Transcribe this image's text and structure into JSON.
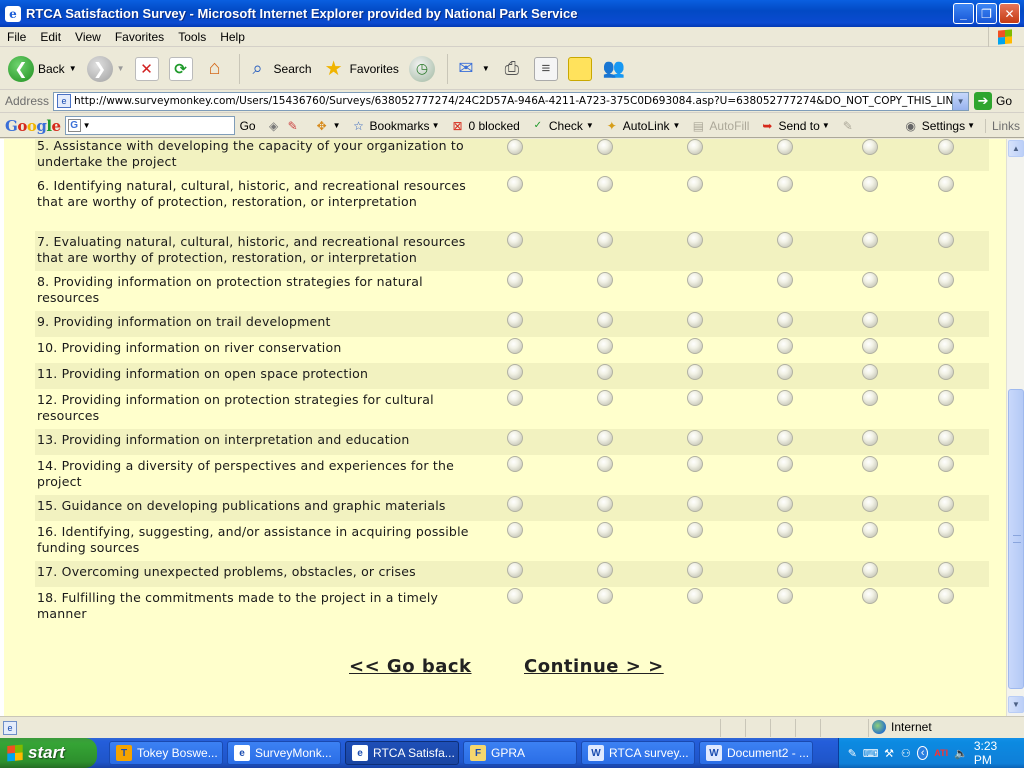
{
  "window": {
    "title": "RTCA Satisfaction Survey - Microsoft Internet Explorer provided by National Park Service",
    "icon_glyph": "e"
  },
  "menu": [
    "File",
    "Edit",
    "View",
    "Favorites",
    "Tools",
    "Help"
  ],
  "toolbar": {
    "back_label": "Back",
    "search_label": "Search",
    "favorites_label": "Favorites"
  },
  "address": {
    "label": "Address",
    "url": "http://www.surveymonkey.com/Users/15436760/Surveys/638052777274/24C2D57A-946A-4211-A723-375C0D693084.asp?U=638052777274&DO_NOT_COPY_THIS_LINK",
    "go_label": "Go"
  },
  "google_toolbar": {
    "logo": "Google",
    "search_icon_glyph": "G",
    "go_label": "Go",
    "bookmarks_label": "Bookmarks",
    "blocked_label": "0 blocked",
    "check_label": "Check",
    "autolink_label": "AutoLink",
    "autofill_label": "AutoFill",
    "sendto_label": "Send to",
    "settings_label": "Settings",
    "links_label": "Links"
  },
  "survey": {
    "questions": [
      {
        "text": "5. Assistance with developing the capacity of your organization to undertake the project"
      },
      {
        "text": "6. Identifying natural, cultural, historic, and recreational resources that are worthy of protection, restoration, or interpretation"
      },
      {
        "text": "7. Evaluating natural, cultural, historic, and recreational resources that are worthy of protection, restoration, or interpretation"
      },
      {
        "text": "8. Providing information on protection strategies for natural resources"
      },
      {
        "text": "9. Providing information on trail development"
      },
      {
        "text": "10. Providing information on river conservation"
      },
      {
        "text": "11. Providing information on open space protection"
      },
      {
        "text": "12. Providing information on protection strategies for cultural resources"
      },
      {
        "text": "13. Providing information on interpretation and education"
      },
      {
        "text": "14. Providing a diversity of perspectives and experiences for the project"
      },
      {
        "text": "15. Guidance on developing publications and graphic materials"
      },
      {
        "text": "16. Identifying, suggesting, and/or assistance in acquiring possible funding sources"
      },
      {
        "text": "17. Overcoming unexpected problems, obstacles, or crises"
      },
      {
        "text": "18. Fulfilling the commitments made to the project in a timely manner"
      }
    ],
    "go_back_label": "<< Go back",
    "continue_label": "Continue > >"
  },
  "status": {
    "zone_label": "Internet"
  },
  "taskbar": {
    "start_label": "start",
    "tasks": [
      {
        "label": "Tokey Boswe...",
        "icon": "T",
        "color": "#f4a300"
      },
      {
        "label": "SurveyMonk...",
        "icon": "e",
        "color": "#ffffff"
      },
      {
        "label": "RTCA Satisfa...",
        "icon": "e",
        "color": "#ffffff",
        "active": true
      },
      {
        "label": "GPRA",
        "icon": "F",
        "color": "#f5d76e"
      },
      {
        "label": "RTCA survey...",
        "icon": "W",
        "color": "#dfe9ff"
      },
      {
        "label": "Document2 - ...",
        "icon": "W",
        "color": "#dfe9ff"
      }
    ],
    "clock": "3:23 PM"
  },
  "colors": {
    "survey_bg": "#ffffcc",
    "row_alt_bg": "#f2f2c0",
    "titlebar_blue": "#0249c4",
    "start_green": "#35a435"
  }
}
